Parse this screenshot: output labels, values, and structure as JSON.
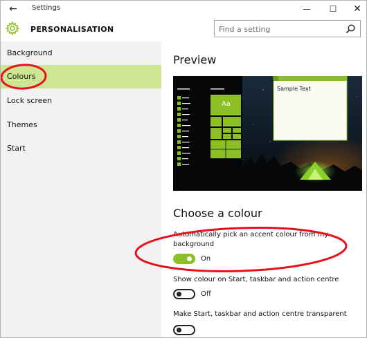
{
  "window": {
    "title": "Settings"
  },
  "header": {
    "page_title": "PERSONALISATION",
    "search_placeholder": "Find a setting"
  },
  "sidebar": {
    "items": [
      {
        "label": "Background",
        "selected": false
      },
      {
        "label": "Colours",
        "selected": true
      },
      {
        "label": "Lock screen",
        "selected": false
      },
      {
        "label": "Themes",
        "selected": false
      },
      {
        "label": "Start",
        "selected": false
      }
    ]
  },
  "main": {
    "preview_title": "Preview",
    "preview": {
      "tile_label": "Aa",
      "sample_text": "Sample Text"
    },
    "choose_title": "Choose a colour",
    "settings": [
      {
        "label": "Automatically pick an accent colour from my background",
        "state": "On",
        "on": true
      },
      {
        "label": "Show colour on Start, taskbar and action centre",
        "state": "Off",
        "on": false
      },
      {
        "label": "Make Start, taskbar and action centre transparent",
        "state": "",
        "on": false
      }
    ]
  },
  "colors": {
    "accent": "#8cbf26",
    "selected_nav": "#cde694",
    "annotation": "#e8101b"
  },
  "icons": {
    "back": "back-arrow-icon",
    "gear": "gear-icon",
    "search": "search-icon"
  }
}
